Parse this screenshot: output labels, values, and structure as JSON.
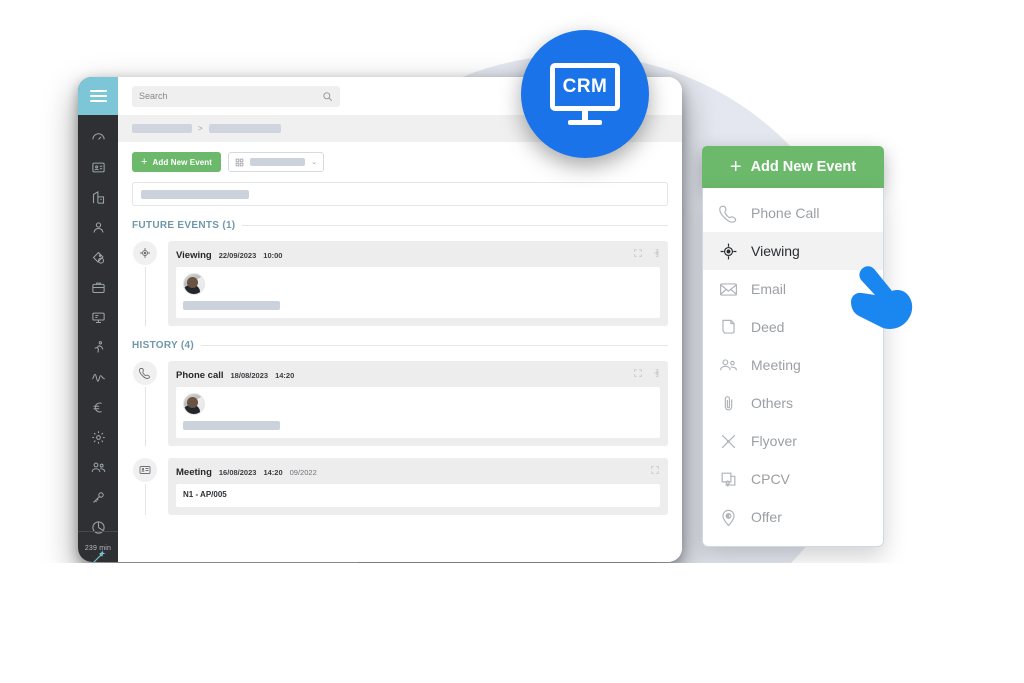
{
  "brand": {
    "badge_text": "CRM",
    "badge_color": "#1a73e8",
    "accent_green": "#6cb96c",
    "accent_teal": "#7cc6d7"
  },
  "rail": {
    "burger_icon": "hamburger-menu-icon",
    "icons": [
      "dashboard-icon",
      "id-card-icon",
      "building-icon",
      "person-icon",
      "tag-shield-icon",
      "briefcase-icon",
      "presentation-icon",
      "running-person-icon",
      "activity-icon",
      "euro-icon",
      "gear-icon",
      "users-icon",
      "key-icon",
      "pie-chart-icon",
      "magic-wand-icon",
      "clock-icon"
    ],
    "accent_icon_index": 14,
    "footer_label": "239 min"
  },
  "topbar": {
    "search": {
      "placeholder": "Search",
      "value": "",
      "icon": "search-icon"
    }
  },
  "breadcrumb": {
    "separator": ">",
    "items": [
      {
        "width": 60
      },
      {
        "width": 72
      }
    ]
  },
  "toolbar": {
    "add_event_label": "Add New Event",
    "add_event_plus": "+",
    "selector": {
      "icon": "grid-icon",
      "chevron": "⌄",
      "value": ""
    }
  },
  "filter": {
    "value": ""
  },
  "sections": [
    {
      "title": "FUTURE EVENTS (1)",
      "events": [
        {
          "icon": "crosshair-target-icon",
          "title": "Viewing",
          "date": "22/09/2023",
          "time": "10:00",
          "extra": "",
          "tools": [
            "expand-icon",
            "open-in-icon"
          ],
          "avatar": "user-avatar",
          "text": ""
        }
      ]
    },
    {
      "title": "HISTORY (4)",
      "events": [
        {
          "icon": "phone-icon",
          "title": "Phone call",
          "date": "18/08/2023",
          "time": "14:20",
          "extra": "",
          "tools": [
            "expand-icon",
            "open-in-icon"
          ],
          "avatar": "user-avatar",
          "text": ""
        },
        {
          "icon": "contact-card-icon",
          "title": "Meeting",
          "date": "16/08/2023",
          "time": "14:20",
          "extra": "09/2022",
          "tools": [
            "expand-icon"
          ],
          "avatar": "",
          "text": "N1 - AP/005"
        }
      ]
    }
  ],
  "dropdown": {
    "button_label": "Add New Event",
    "button_plus": "+",
    "items": [
      {
        "label": "Phone Call",
        "icon": "phone-icon",
        "active": false
      },
      {
        "label": "Viewing",
        "icon": "crosshair-target-icon",
        "active": true
      },
      {
        "label": "Email",
        "icon": "envelope-icon",
        "active": false
      },
      {
        "label": "Deed",
        "icon": "document-icon",
        "active": false
      },
      {
        "label": "Meeting",
        "icon": "people-icon",
        "active": false
      },
      {
        "label": "Others",
        "icon": "paperclip-icon",
        "active": false
      },
      {
        "label": "Flyover",
        "icon": "airplane-icon",
        "active": false
      },
      {
        "label": "CPCV",
        "icon": "contract-stamp-icon",
        "active": false
      },
      {
        "label": "Offer",
        "icon": "map-pin-euro-icon",
        "active": false
      }
    ]
  },
  "cursor": {
    "icon": "pointing-hand-cursor",
    "color": "#1a86f0"
  }
}
